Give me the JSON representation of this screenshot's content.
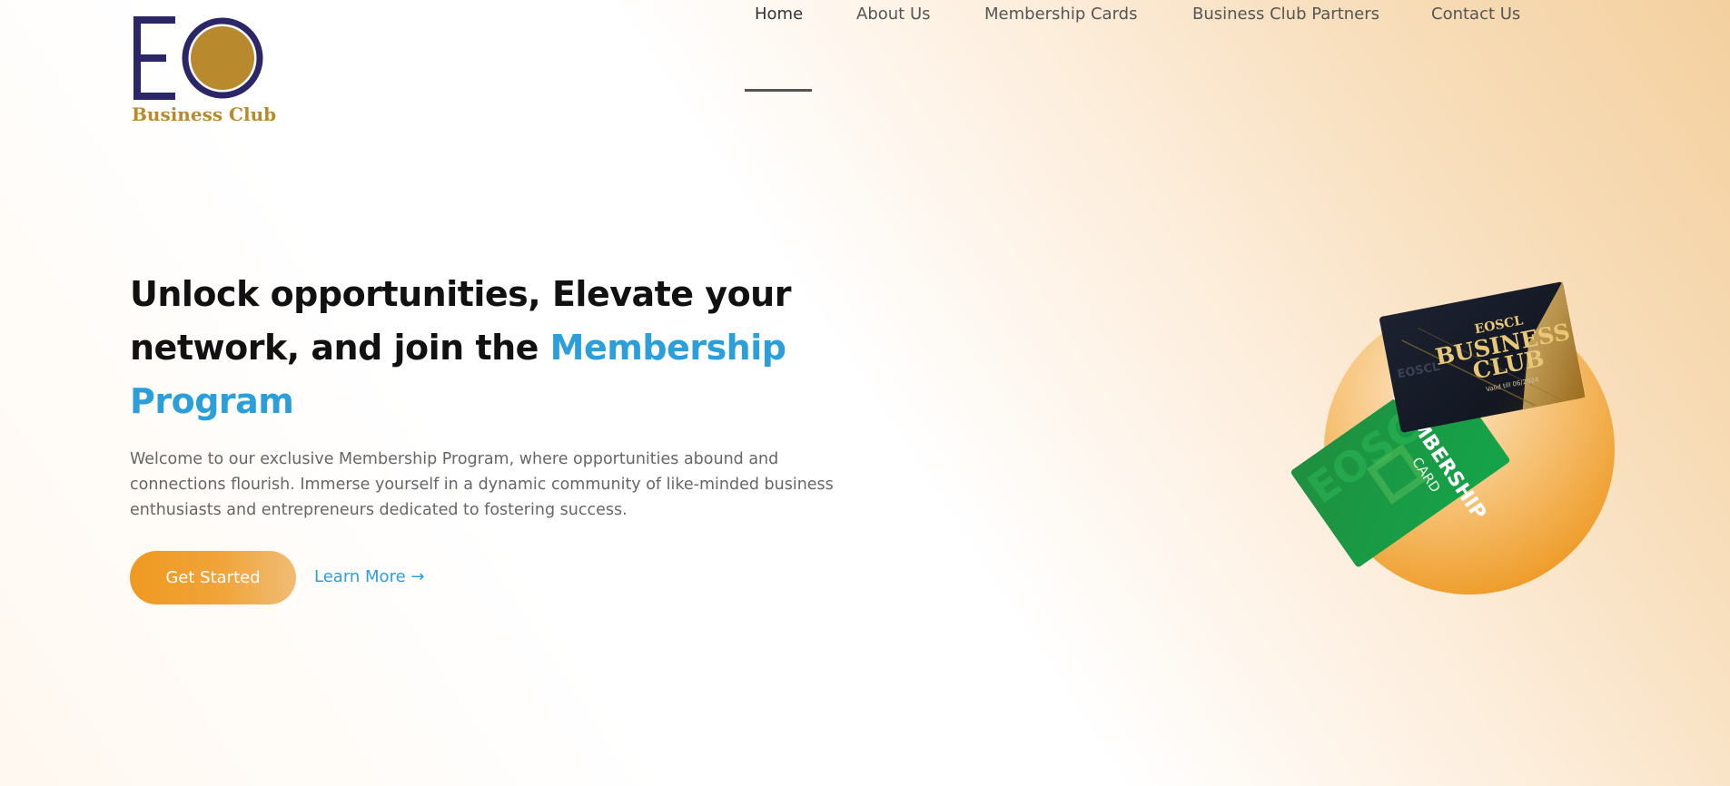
{
  "brand": {
    "logo_text": "Business Club",
    "colors": {
      "navy": "#2a2668",
      "gold": "#b88a2d",
      "accent_blue": "#2b9fd9",
      "orange": "#ef9921"
    }
  },
  "nav": {
    "items": [
      {
        "label": "Home",
        "active": true
      },
      {
        "label": "About Us"
      },
      {
        "label": "Membership Cards"
      },
      {
        "label": "Business Club Partners"
      },
      {
        "label": "Contact Us"
      }
    ]
  },
  "hero": {
    "title_main": "Unlock opportunities, Elevate your network, and join the ",
    "title_accent": "Membership Program",
    "description": "Welcome to our exclusive Membership Program, where opportunities abound and connections flourish. Immerse yourself in a dynamic community of like-minded business enthusiasts and entrepreneurs dedicated to fostering success.",
    "primary_button": "Get Started",
    "secondary_link": "Learn More →"
  },
  "cards": {
    "green_card": {
      "brand": "EOSCL",
      "title": "MEMBERSHIP",
      "subtitle": "CARD"
    },
    "dark_card": {
      "brand": "EOSCL",
      "title_line1": "BUSINESS",
      "title_line2": "CLUB",
      "valid": "Valid till 06/2024"
    }
  }
}
